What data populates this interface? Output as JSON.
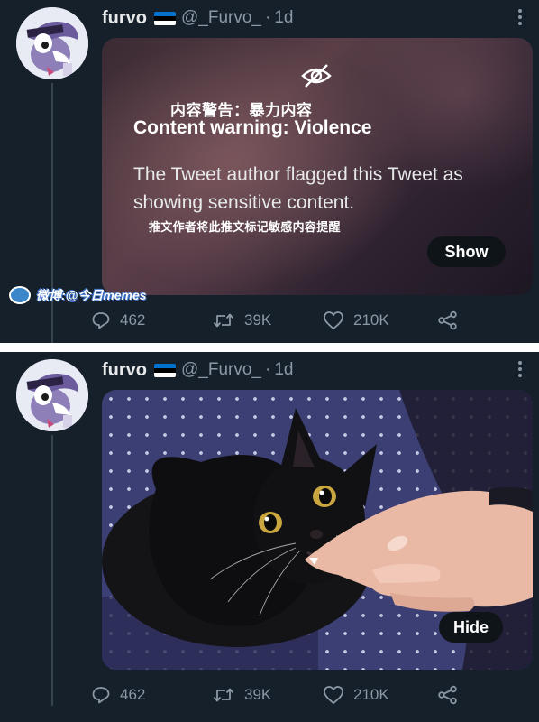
{
  "tweets": [
    {
      "user": {
        "name": "furvo",
        "handle": "@_Furvo_",
        "separator": "·",
        "time": "1d"
      },
      "media": {
        "cn_warning": "内容警告：暴力内容",
        "warning_title": "Content warning: Violence",
        "warning_body": "The Tweet author flagged this Tweet as showing sensitive content.",
        "cn_body": "推文作者将此推文标记敏感内容提醒",
        "button": "Show"
      },
      "watermark": "微博:@今日memes",
      "actions": {
        "replies": "462",
        "retweets": "39K",
        "likes": "210K"
      }
    },
    {
      "user": {
        "name": "furvo",
        "handle": "@_Furvo_",
        "separator": "·",
        "time": "1d"
      },
      "media": {
        "button": "Hide"
      },
      "actions": {
        "replies": "462",
        "retweets": "39K",
        "likes": "210K"
      }
    }
  ],
  "icons": {
    "flag": "estonia-flag",
    "more": "more-vertical-icon",
    "warning": "eye-off-icon",
    "reply": "reply-icon",
    "retweet": "retweet-icon",
    "like": "heart-icon",
    "share": "share-icon"
  },
  "colors": {
    "background": "#15202b",
    "text": "#e7e9ea",
    "muted": "#8b98a5",
    "divider": "#ffffff",
    "flag_blue": "#0072ce",
    "flag_black": "#000000",
    "flag_white": "#ffffff"
  }
}
